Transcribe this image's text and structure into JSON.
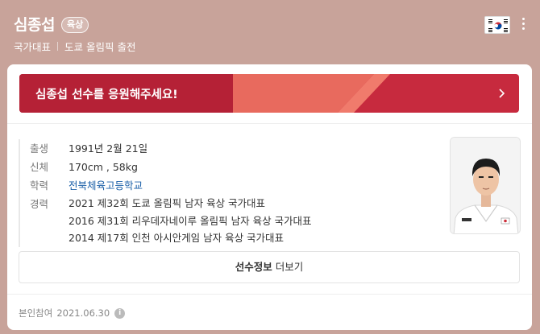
{
  "header": {
    "name": "심종섭",
    "sport_badge": "육상",
    "subtitle_1": "국가대표",
    "subtitle_2": "도쿄 올림픽 출전",
    "flag_icon": "korea-flag-icon",
    "menu_icon": "more-vertical-icon"
  },
  "cheer": {
    "text": "심종섭 선수를 응원해주세요!",
    "arrow_icon": "chevron-right-icon",
    "color": "#c72a3e"
  },
  "profile": {
    "birth": {
      "label": "출생",
      "value": "1991년 2월 21일"
    },
    "body": {
      "label": "신체",
      "value": "170cm , 58kg"
    },
    "school": {
      "label": "학력",
      "value": "전북체육고등학교"
    },
    "career": {
      "label": "경력",
      "items": [
        "2021 제32회 도쿄 올림픽 남자 육상 국가대표",
        "2016 제31회 리우데자네이루 올림픽 남자 육상 국가대표",
        "2014 제17회 인천 아시안게임 남자 육상 국가대표"
      ]
    }
  },
  "more_button": {
    "bold": "선수정보",
    "normal": "더보기"
  },
  "footer": {
    "text": "본인참여",
    "date": "2021.06.30",
    "info_icon": "info-icon"
  },
  "colors": {
    "background": "#c8a39a",
    "link": "#1a5fa8"
  }
}
